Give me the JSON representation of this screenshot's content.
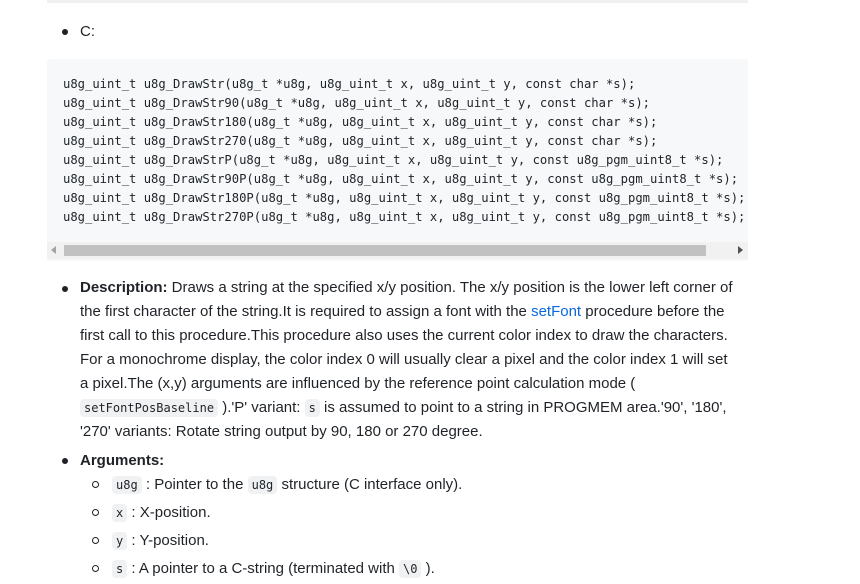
{
  "list_item_c": {
    "label": "C:"
  },
  "code": {
    "lines": [
      "u8g_uint_t u8g_DrawStr(u8g_t *u8g, u8g_uint_t x, u8g_uint_t y, const char *s);",
      "u8g_uint_t u8g_DrawStr90(u8g_t *u8g, u8g_uint_t x, u8g_uint_t y, const char *s);",
      "u8g_uint_t u8g_DrawStr180(u8g_t *u8g, u8g_uint_t x, u8g_uint_t y, const char *s);",
      "u8g_uint_t u8g_DrawStr270(u8g_t *u8g, u8g_uint_t x, u8g_uint_t y, const char *s);",
      "u8g_uint_t u8g_DrawStrP(u8g_t *u8g, u8g_uint_t x, u8g_uint_t y, const u8g_pgm_uint8_t *s);",
      "u8g_uint_t u8g_DrawStr90P(u8g_t *u8g, u8g_uint_t x, u8g_uint_t y, const u8g_pgm_uint8_t *s);",
      "u8g_uint_t u8g_DrawStr180P(u8g_t *u8g, u8g_uint_t x, u8g_uint_t y, const u8g_pgm_uint8_t *s);",
      "u8g_uint_t u8g_DrawStr270P(u8g_t *u8g, u8g_uint_t x, u8g_uint_t y, const u8g_pgm_uint8_t *s);"
    ]
  },
  "description": {
    "label": "Description:",
    "text_1": " Draws a string at the specified x/y position. The x/y position is the lower left corner of the first character of the string.It is required to assign a font with the ",
    "link": "setFont",
    "text_2": " procedure before the first call to this procedure.This procedure also uses the current color index to draw the characters. For a monochrome display, the color index 0 will usually clear a pixel and the color index 1 will set a pixel.The (x,y) arguments are influenced by the reference point calculation mode ( ",
    "code_1": "setFontPosBaseline",
    "text_3": " ).'P' variant: ",
    "code_2": "s",
    "text_4": " is assumed to point to a string in PROGMEM area.'90', '180', '270' variants: Rotate string output by 90, 180 or 270 degree."
  },
  "arguments": {
    "label": "Arguments:",
    "items": [
      {
        "code": "u8g",
        "text": " : Pointer to the ",
        "code2": "u8g",
        "text2": " structure (C interface only)."
      },
      {
        "code": "x",
        "text": " : X-position."
      },
      {
        "code": "y",
        "text": " : Y-position."
      },
      {
        "code": "s",
        "text": " : A pointer to a C-string (terminated with ",
        "code2": "\\0",
        "text2": " )."
      }
    ]
  }
}
